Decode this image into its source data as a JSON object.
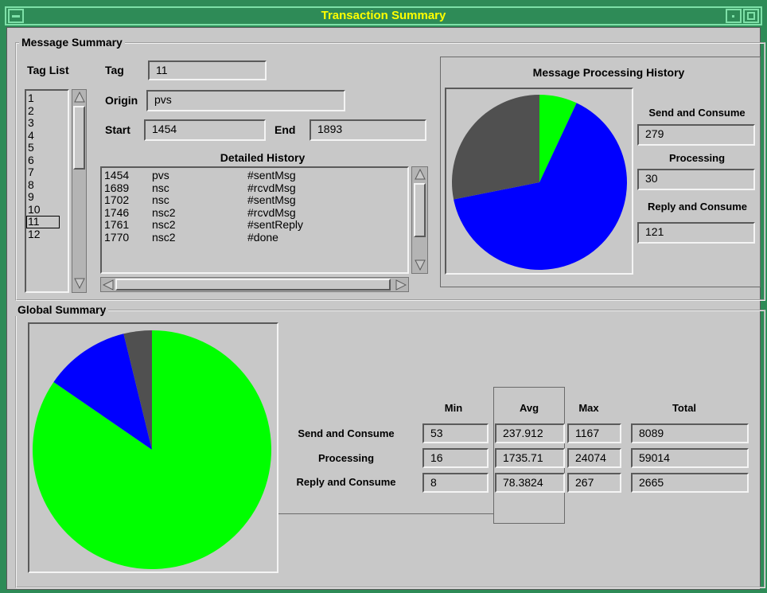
{
  "window": {
    "title": "Transaction Summary"
  },
  "message_summary": {
    "group_label": "Message Summary",
    "tag_list_label": "Tag List",
    "tag_list": [
      "1",
      "2",
      "3",
      "4",
      "5",
      "6",
      "7",
      "8",
      "9",
      "10",
      "11",
      "12"
    ],
    "selected_tag": "11",
    "tag_label": "Tag",
    "tag_value": "11",
    "origin_label": "Origin",
    "origin_value": "pvs",
    "start_label": "Start",
    "start_value": "1454",
    "end_label": "End",
    "end_value": "1893",
    "history_label": "Detailed History",
    "history": [
      {
        "time": "1454",
        "node": "pvs",
        "event": "#sentMsg"
      },
      {
        "time": "1689",
        "node": "nsc",
        "event": "#rcvdMsg"
      },
      {
        "time": "1702",
        "node": "nsc",
        "event": "#sentMsg"
      },
      {
        "time": "1746",
        "node": "nsc2",
        "event": "#rcvdMsg"
      },
      {
        "time": "1761",
        "node": "nsc2",
        "event": "#sentReply"
      },
      {
        "time": "1770",
        "node": "nsc2",
        "event": "#done"
      }
    ]
  },
  "message_history": {
    "title": "Message Processing History",
    "send_label": "Send and Consume",
    "send_value": "279",
    "processing_label": "Processing",
    "processing_value": "30",
    "reply_label": "Reply and Consume",
    "reply_value": "121"
  },
  "global_summary": {
    "group_label": "Global Summary",
    "columns": {
      "min": "Min",
      "avg": "Avg",
      "max": "Max",
      "total": "Total"
    },
    "rows": [
      {
        "label": "Send and Consume",
        "min": "53",
        "avg": "237.912",
        "max": "1167",
        "total": "8089"
      },
      {
        "label": "Processing",
        "min": "16",
        "avg": "1735.71",
        "max": "24074",
        "total": "59014"
      },
      {
        "label": "Reply and Consume",
        "min": "8",
        "avg": "78.3824",
        "max": "267",
        "total": "2665"
      }
    ]
  },
  "chart_data": [
    {
      "type": "pie",
      "title": "Message Processing History",
      "labels": [
        "Processing",
        "Send and Consume",
        "Reply and Consume"
      ],
      "values": [
        30,
        279,
        121
      ],
      "colors": [
        "#00ff00",
        "#0000ff",
        "#505050"
      ]
    },
    {
      "type": "pie",
      "title": "",
      "labels": [
        "Processing",
        "Send and Consume",
        "Reply and Consume"
      ],
      "values": [
        59014,
        8089,
        2665
      ],
      "colors": [
        "#00ff00",
        "#0000ff",
        "#505050"
      ]
    }
  ]
}
